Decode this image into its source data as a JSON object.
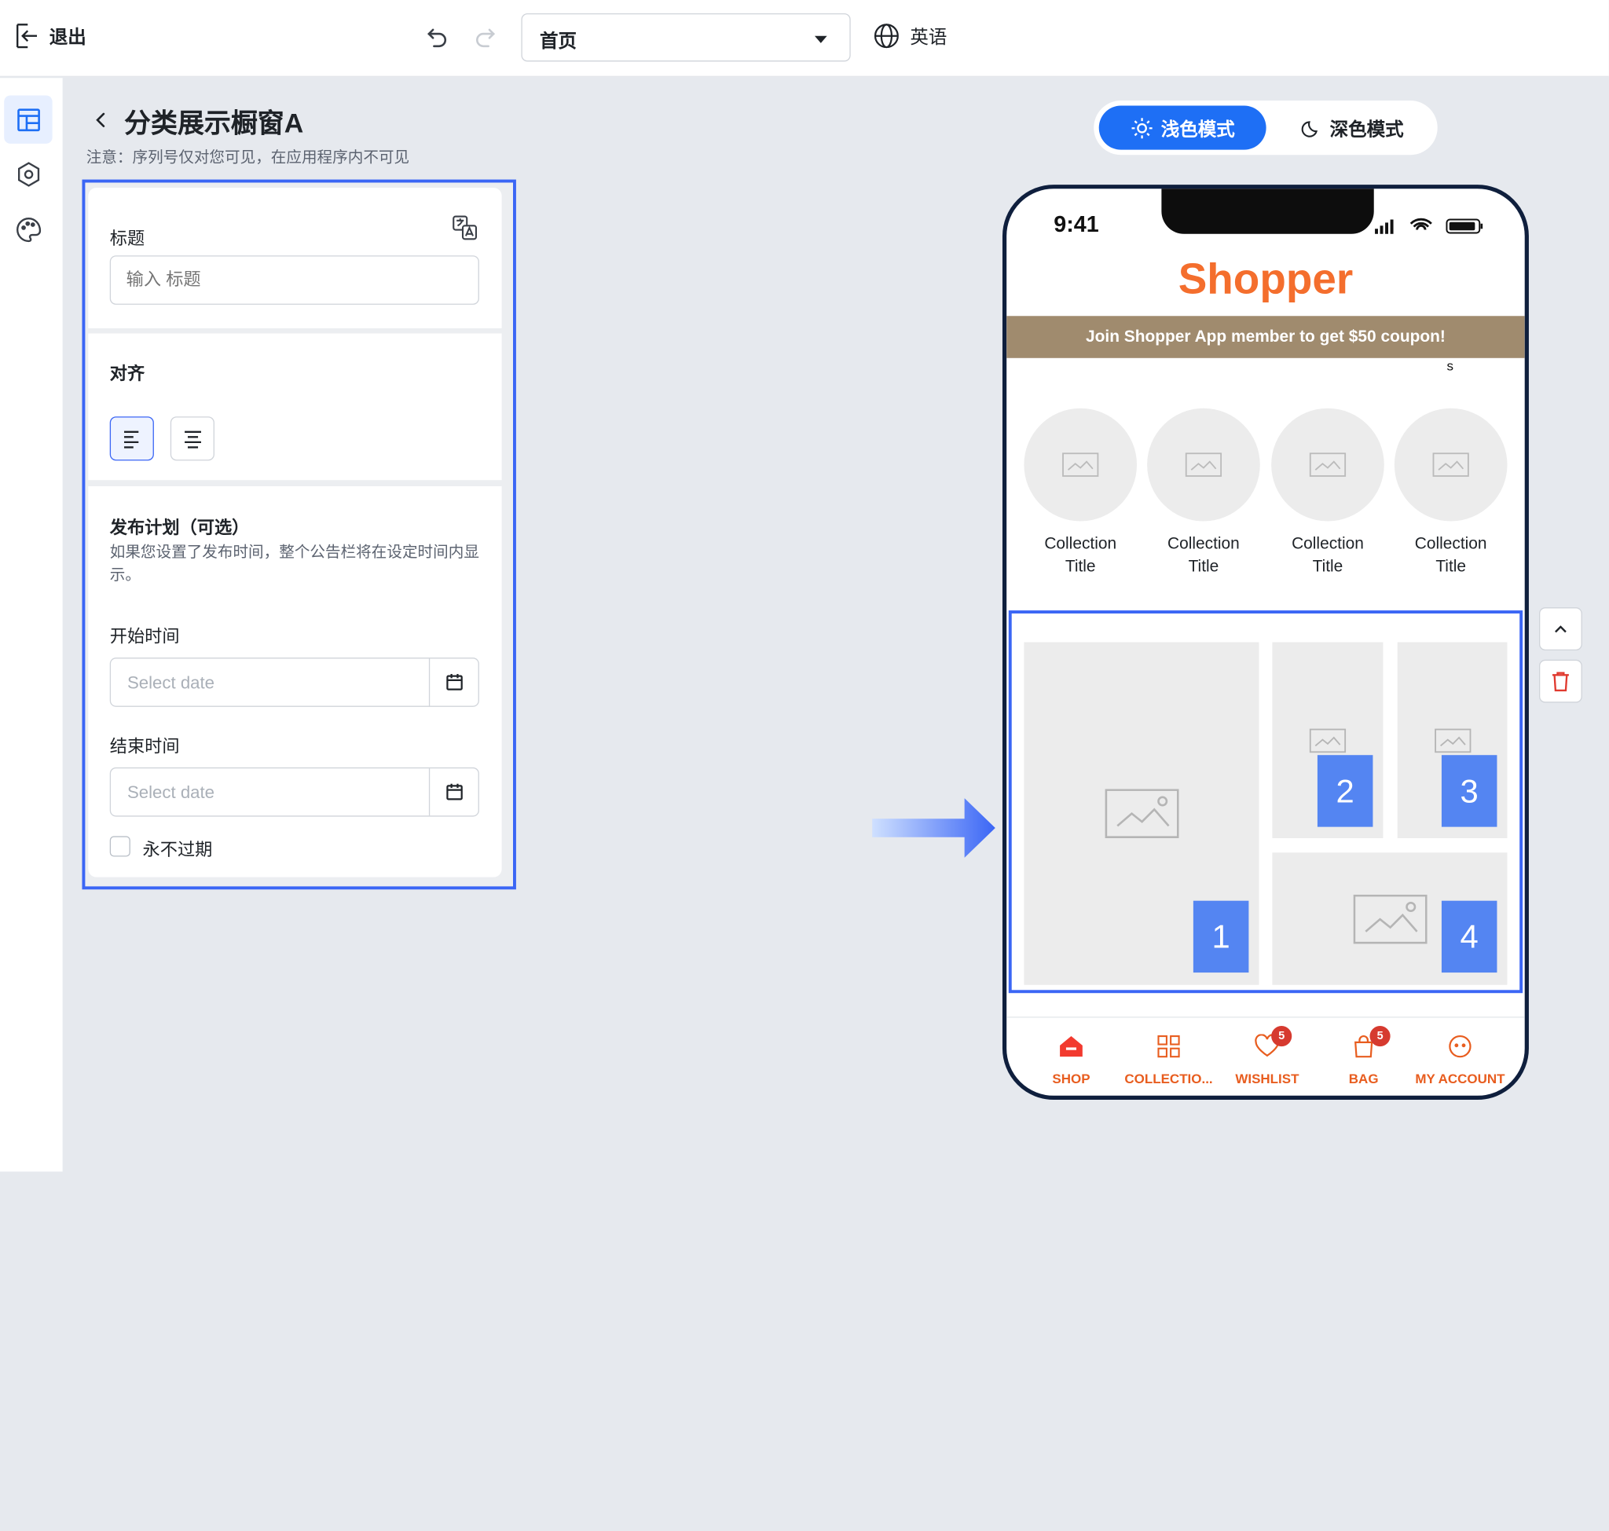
{
  "topbar": {
    "exit_label": "退出",
    "page_select_value": "首页",
    "language_label": "英语"
  },
  "editor": {
    "title": "分类展示橱窗A",
    "note": "注意：序列号仅对您可见，在应用程序内不可见",
    "title_section": {
      "label": "标题",
      "placeholder": "输入 标题"
    },
    "align_section": {
      "label": "对齐",
      "selected": "left"
    },
    "schedule_section": {
      "label": "发布计划（可选）",
      "description": "如果您设置了发布时间，整个公告栏将在设定时间内显示。",
      "start_label": "开始时间",
      "start_placeholder": "Select date",
      "end_label": "结束时间",
      "end_placeholder": "Select date",
      "never_expire_label": "永不过期",
      "never_expire_checked": false
    }
  },
  "theme_toggle": {
    "light_label": "浅色模式",
    "dark_label": "深色模式",
    "selected": "light"
  },
  "preview": {
    "time": "9:41",
    "brand": "Shopper",
    "promo": "Join Shopper App member to get $50 coupon!",
    "stray_char": "s",
    "collections": [
      {
        "line1": "Collection",
        "line2": "Title"
      },
      {
        "line1": "Collection",
        "line2": "Title"
      },
      {
        "line1": "Collection",
        "line2": "Title"
      },
      {
        "line1": "Collection",
        "line2": "Title"
      }
    ],
    "tile_numbers": [
      "1",
      "2",
      "3",
      "4"
    ],
    "tabs": [
      {
        "label": "SHOP",
        "icon": "home-icon"
      },
      {
        "label": "COLLECTIO...",
        "icon": "grid-icon"
      },
      {
        "label": "WISHLIST",
        "icon": "heart-icon",
        "badge": "5"
      },
      {
        "label": "BAG",
        "icon": "bag-icon",
        "badge": "5"
      },
      {
        "label": "MY ACCOUNT",
        "icon": "account-icon"
      }
    ]
  },
  "colors": {
    "accent": "#3b66f5",
    "brand": "#f46e2d",
    "promo_bg": "#a08b6e",
    "tile_number_bg": "#5485f2",
    "tab_active": "#e85d1f"
  }
}
